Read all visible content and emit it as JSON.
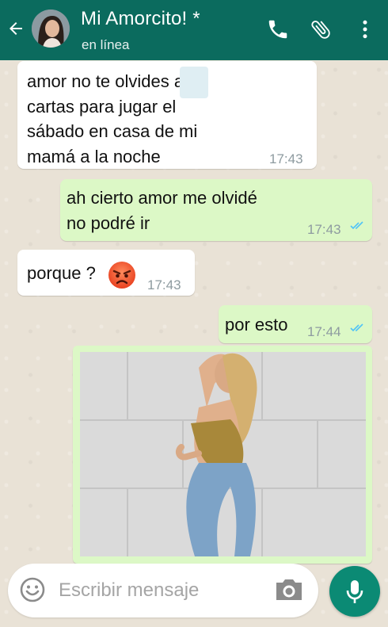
{
  "header": {
    "contact_name": "Mi Amorcito! *",
    "status": "en línea",
    "icons": [
      "back-arrow-icon",
      "phone-icon",
      "paperclip-icon",
      "more-vert-icon"
    ]
  },
  "messages": [
    {
      "direction": "incoming",
      "lines": [
        "amor no te olvides  as",
        "cartas para jugar el",
        "sábado en casa de mi",
        "mamá a la noche"
      ],
      "time": "17:43"
    },
    {
      "direction": "outgoing",
      "lines": [
        "ah cierto amor me olvidé",
        "no podré ir"
      ],
      "time": "17:43",
      "read": true
    },
    {
      "direction": "incoming",
      "text": "porque ?",
      "emoji": "angry-face",
      "time": "17:43"
    },
    {
      "direction": "outgoing",
      "text": "por esto",
      "time": "17:44",
      "read": true
    },
    {
      "direction": "outgoing",
      "type": "image"
    }
  ],
  "composer": {
    "placeholder": "Escribir mensaje",
    "icons": [
      "emoji-icon",
      "camera-icon",
      "microphone-icon"
    ]
  },
  "colors": {
    "header": "#0b6b5e",
    "outgoing_bubble": "#dcf8c6",
    "incoming_bubble": "#ffffff",
    "read_ticks": "#4fc3f7",
    "mic_button": "#0b8a74"
  }
}
